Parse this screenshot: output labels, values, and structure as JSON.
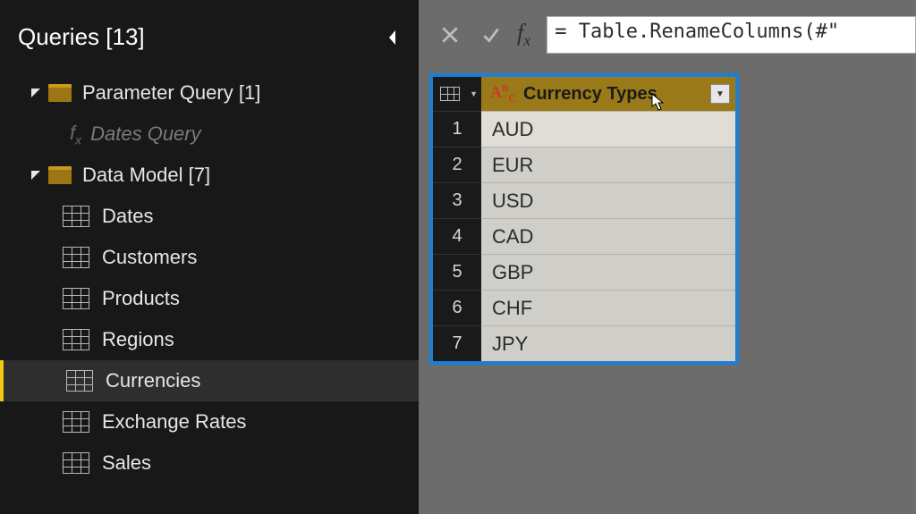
{
  "sidebar": {
    "title": "Queries [13]",
    "groups": [
      {
        "label": "Parameter Query [1]",
        "type": "folder",
        "items": [
          {
            "label": "Dates Query",
            "type": "fx"
          }
        ]
      },
      {
        "label": "Data Model [7]",
        "type": "folder",
        "items": [
          {
            "label": "Dates",
            "type": "table"
          },
          {
            "label": "Customers",
            "type": "table"
          },
          {
            "label": "Products",
            "type": "table"
          },
          {
            "label": "Regions",
            "type": "table"
          },
          {
            "label": "Currencies",
            "type": "table",
            "selected": true
          },
          {
            "label": "Exchange Rates",
            "type": "table"
          },
          {
            "label": "Sales",
            "type": "table"
          }
        ]
      }
    ]
  },
  "formula_bar": {
    "formula": "= Table.RenameColumns(#\""
  },
  "table": {
    "column_header": "Currency Types",
    "rows": [
      {
        "n": "1",
        "v": "AUD"
      },
      {
        "n": "2",
        "v": "EUR"
      },
      {
        "n": "3",
        "v": "USD"
      },
      {
        "n": "4",
        "v": "CAD"
      },
      {
        "n": "5",
        "v": "GBP"
      },
      {
        "n": "6",
        "v": "CHF"
      },
      {
        "n": "7",
        "v": "JPY"
      }
    ]
  }
}
